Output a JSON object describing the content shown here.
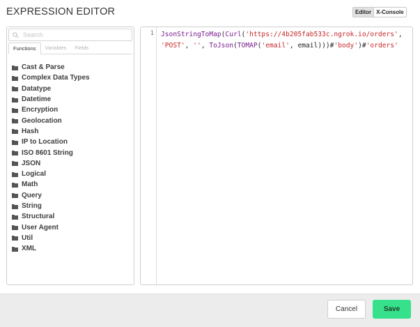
{
  "header": {
    "title": "EXPRESSION EDITOR",
    "modes": [
      {
        "label": "Editor",
        "active": true
      },
      {
        "label": "X-Console",
        "active": false
      }
    ]
  },
  "sidebar": {
    "search_placeholder": "Search",
    "tabs": [
      {
        "label": "Functions",
        "active": true
      },
      {
        "label": "Variables",
        "active": false
      },
      {
        "label": "Fields",
        "active": false
      }
    ],
    "folders": [
      "Cast & Parse",
      "Complex Data Types",
      "Datatype",
      "Datetime",
      "Encryption",
      "Geolocation",
      "Hash",
      "IP to Location",
      "ISO 8601 String",
      "JSON",
      "Logical",
      "Math",
      "Query",
      "String",
      "Structural",
      "User Agent",
      "Util",
      "XML"
    ]
  },
  "editor": {
    "line_numbers": [
      "1"
    ],
    "tokens": [
      {
        "t": "JsonStringToMap",
        "k": "fn"
      },
      {
        "t": "(",
        "k": "plain"
      },
      {
        "t": "Curl",
        "k": "fn"
      },
      {
        "t": "(",
        "k": "plain"
      },
      {
        "t": "'https://4b205fab533c.ngrok.io/orders'",
        "k": "str"
      },
      {
        "t": ", ",
        "k": "plain"
      },
      {
        "t": "'POST'",
        "k": "str"
      },
      {
        "t": ", ",
        "k": "plain"
      },
      {
        "t": "''",
        "k": "str"
      },
      {
        "t": ", ",
        "k": "plain"
      },
      {
        "t": "ToJson",
        "k": "fn"
      },
      {
        "t": "(",
        "k": "plain"
      },
      {
        "t": "TOMAP",
        "k": "fn"
      },
      {
        "t": "(",
        "k": "plain"
      },
      {
        "t": "'email'",
        "k": "str"
      },
      {
        "t": ", email)))#",
        "k": "plain"
      },
      {
        "t": "'body'",
        "k": "str"
      },
      {
        "t": ")#",
        "k": "plain"
      },
      {
        "t": "'orders'",
        "k": "str"
      }
    ]
  },
  "footer": {
    "cancel_label": "Cancel",
    "save_label": "Save"
  },
  "colors": {
    "function_token": "#7a1e8e",
    "string_token": "#c62828",
    "save_button": "#37e08a"
  },
  "icons": {
    "search": "search-icon",
    "folder": "folder-icon"
  }
}
